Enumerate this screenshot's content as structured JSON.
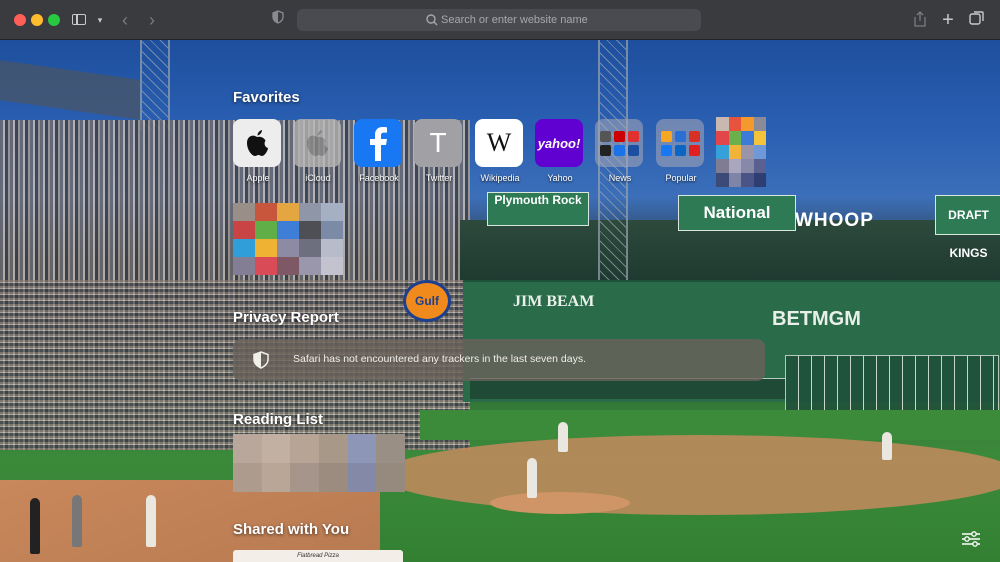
{
  "toolbar": {
    "address_placeholder": "Search or enter website name"
  },
  "icons": {
    "sidebar": "sidebar-icon",
    "tab_overview": "tab-overview-icon",
    "new_tab": "plus-icon",
    "share": "share-icon",
    "privacy": "shield-icon"
  },
  "favorites": {
    "title": "Favorites",
    "items": [
      {
        "label": "Apple"
      },
      {
        "label": "iCloud"
      },
      {
        "label": "Facebook"
      },
      {
        "label": "Twitter",
        "glyph": "T"
      },
      {
        "label": "Wikipedia",
        "glyph": "W"
      },
      {
        "label": "Yahoo",
        "glyph": "yahoo!"
      },
      {
        "label": "News"
      },
      {
        "label": "Popular"
      }
    ]
  },
  "privacy_report": {
    "title": "Privacy Report",
    "message": "Safari has not encountered any trackers in the last seven days."
  },
  "reading_list": {
    "title": "Reading List"
  },
  "shared_with_you": {
    "title": "Shared with You",
    "card_text": "Flatbread Pizza"
  },
  "background_signs": {
    "plymouth": "Plymouth Rock",
    "national": "National",
    "whoop": "WHOOP",
    "draftkings": "DRAFT KINGS",
    "jimbeam": "JIM BEAM",
    "betmgm": "BETMGM",
    "gulf": "Gulf"
  },
  "colors": {
    "titlebar": "#3a3b3f",
    "close": "#ff5f57",
    "minimize": "#febc2e",
    "zoom": "#28c840",
    "facebook": "#1877f2",
    "yahoo": "#6001d2"
  }
}
